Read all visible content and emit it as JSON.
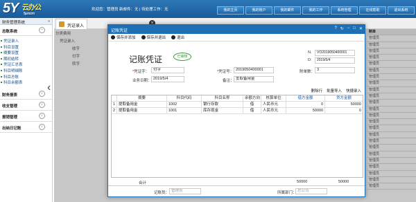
{
  "logo": {
    "text": "5Y",
    "cn": "云办公",
    "url": "5yun.com"
  },
  "header": {
    "welcome": "欢迎您：管理员 新邮件：无 | 待处理工作：无"
  },
  "nav": [
    "我的主页",
    "我的账户",
    "我的邮件",
    "我的工作",
    "系统管理",
    "在线帮助",
    "退出系统"
  ],
  "sidebar": {
    "title": "财务管理系统",
    "groups": [
      {
        "label": "总账系统",
        "icon": "minus"
      },
      {
        "label": "财务报表",
        "icon": "down"
      },
      {
        "label": "收支管理",
        "icon": "down"
      },
      {
        "label": "报销管理",
        "icon": "down"
      },
      {
        "label": "出纳日记账",
        "icon": "down"
      }
    ],
    "items": [
      "凭证录入",
      "科目设置",
      "摘要设置",
      "期初结转",
      "凭证汇总表",
      "科目明细账",
      "科目总账",
      "科目余额表"
    ]
  },
  "tab": {
    "label": "凭证录入"
  },
  "tree": [
    "分类费用",
    "凭证录入",
    "收字",
    "付字",
    "转字"
  ],
  "bg_table": {
    "header": "制单",
    "rows": [
      "管理员",
      "管理员",
      "管理员",
      "管理员",
      "管理员",
      "管理员",
      "管理员",
      "管理员",
      "管理员",
      "管理员",
      "管理员",
      "管理员",
      "管理员",
      "管理员",
      "管理员",
      "管理员",
      "管理员",
      "管理员",
      "管理员",
      "管理员",
      "管理员",
      "管理员",
      "管理员",
      "管理员"
    ]
  },
  "dialog": {
    "title": "记账凭证",
    "tools": [
      "保存并添加",
      "保存并退出",
      "退出"
    ],
    "voucher_title": "记账凭证",
    "stamp": "已审核",
    "no_label": "N.",
    "no_value": "VO2019050400001",
    "d_label": "D:",
    "d_value": "2019/5/4",
    "type_label": "凭证字：",
    "type_value": "付字",
    "code_label": "凭证号：",
    "code_value": "2019050400001",
    "attach_label": "附单数：",
    "attach_value": "3",
    "date_label": "业务日期：",
    "date_value": "2019/5/4",
    "note_label": "备注：",
    "note_value": "支取备用金",
    "table_tools": [
      "删除行",
      "批量导入",
      "快捷录入"
    ],
    "columns": [
      "摘要",
      "科目代码",
      "科目名称",
      "余额方向",
      "核算单位",
      "借方金额",
      "贷方金额"
    ],
    "rows": [
      {
        "n": "1",
        "summary": "提取备用金",
        "code": "1002",
        "name": "银行存款",
        "dir": "借",
        "unit": "人民币元",
        "debit": "0",
        "credit": "50000"
      },
      {
        "n": "2",
        "summary": "提取备用金",
        "code": "1001",
        "name": "库存现金",
        "dir": "借",
        "unit": "人民币元",
        "debit": "50000",
        "credit": "0"
      }
    ],
    "total_label": "合计",
    "total_debit": "50000",
    "total_credit": "50000",
    "maker_label": "记账员：",
    "maker_value": "管理员",
    "dept_label": "所属部门：",
    "dept_value": "总公司"
  }
}
